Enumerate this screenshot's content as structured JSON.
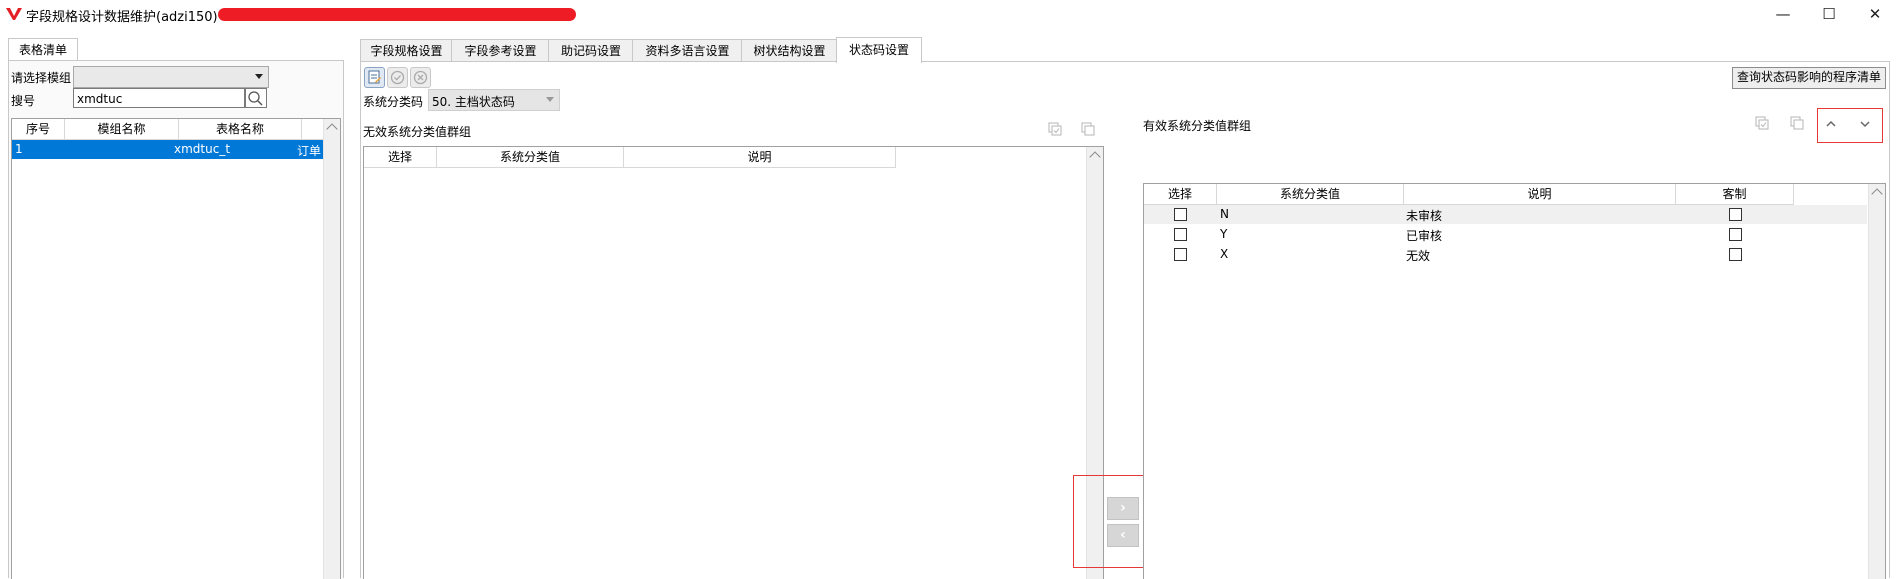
{
  "window": {
    "title": "字段规格设计数据维护(adzi150)",
    "minimize": "—",
    "maximize": "☐",
    "close": "✕"
  },
  "left": {
    "tab_label": "表格清单",
    "module_label": "请选择模组",
    "module_value": "",
    "search_label": "搜号",
    "search_value": "xmdtuc",
    "columns": [
      "序号",
      "模组名称",
      "表格名称",
      ""
    ],
    "rows": [
      {
        "seq": "1",
        "module": "",
        "table": "xmdtuc_t",
        "extra": "订单"
      }
    ]
  },
  "tabs": [
    "字段规格设置",
    "字段参考设置",
    "助记码设置",
    "资料多语言设置",
    "树状结构设置",
    "状态码设置"
  ],
  "active_tab": 5,
  "status": {
    "category_label": "系统分类码",
    "category_value": "50. 主档状态码",
    "query_button": "查询状态码影响的程序清单",
    "invalid_group_label": "无效系统分类值群组",
    "valid_group_label": "有效系统分类值群组",
    "invalid_columns": [
      "选择",
      "系统分类值",
      "说明"
    ],
    "valid_columns": [
      "选择",
      "系统分类值",
      "说明",
      "客制"
    ],
    "valid_rows": [
      {
        "value": "N",
        "desc": "未审核",
        "selected": false,
        "custom": false
      },
      {
        "value": "Y",
        "desc": "已审核",
        "selected": false,
        "custom": false
      },
      {
        "value": "X",
        "desc": "无效",
        "selected": false,
        "custom": false
      }
    ],
    "move_right": "›",
    "move_left": "‹",
    "up_icon": "chevron-up-icon",
    "down_icon": "chevron-down-icon"
  },
  "colors": {
    "selection": "#0078d7",
    "highlight_box": "#e53935",
    "brand": "#e53935"
  }
}
